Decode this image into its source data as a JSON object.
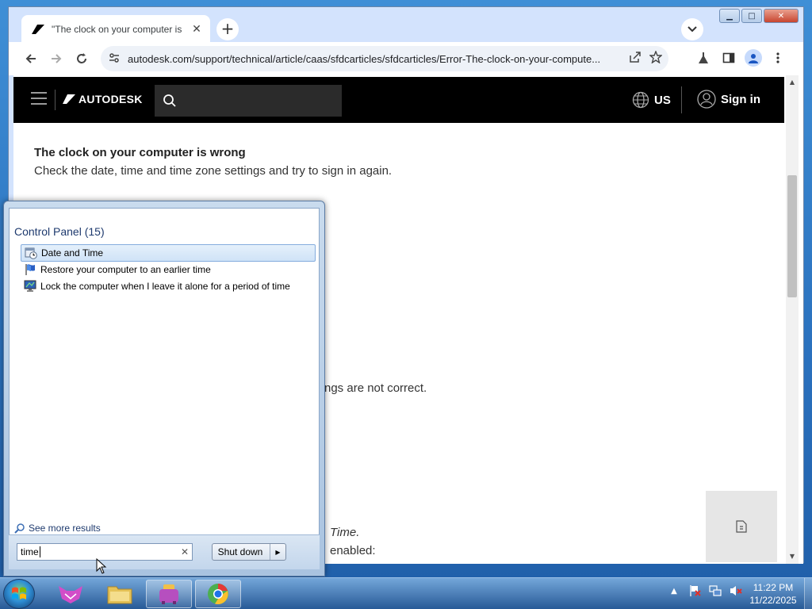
{
  "browser": {
    "tab_title": "\"The clock on your computer is",
    "url": "autodesk.com/support/technical/article/caas/sfdcarticles/sfdcarticles/Error-The-clock-on-your-compute..."
  },
  "site": {
    "logo_text": "AUTODESK",
    "region": "US",
    "signin": "Sign in"
  },
  "article": {
    "title": "The clock on your computer is wrong",
    "subtitle": "Check the date, time and time zone settings and try to sign in again.",
    "fragment_1": "ngs are not correct.",
    "fragment_2": "Time.",
    "fragment_3": "enabled:"
  },
  "start_menu": {
    "group_label": "Control Panel (15)",
    "results": [
      {
        "label": "Date and Time",
        "icon": "calendar-clock-icon"
      },
      {
        "label": "Restore your computer to an earlier time",
        "icon": "flag-icon"
      },
      {
        "label": "Lock the computer when I leave it alone for a period of time",
        "icon": "monitor-icon"
      }
    ],
    "see_more": "See more results",
    "search_value": "time",
    "shutdown_label": "Shut down"
  },
  "taskbar": {
    "time": "11:22 PM",
    "date": "11/22/2025"
  },
  "colors": {
    "header_bg": "#000000",
    "selection": "#cfe3f7",
    "group_text": "#1e3a6e"
  }
}
